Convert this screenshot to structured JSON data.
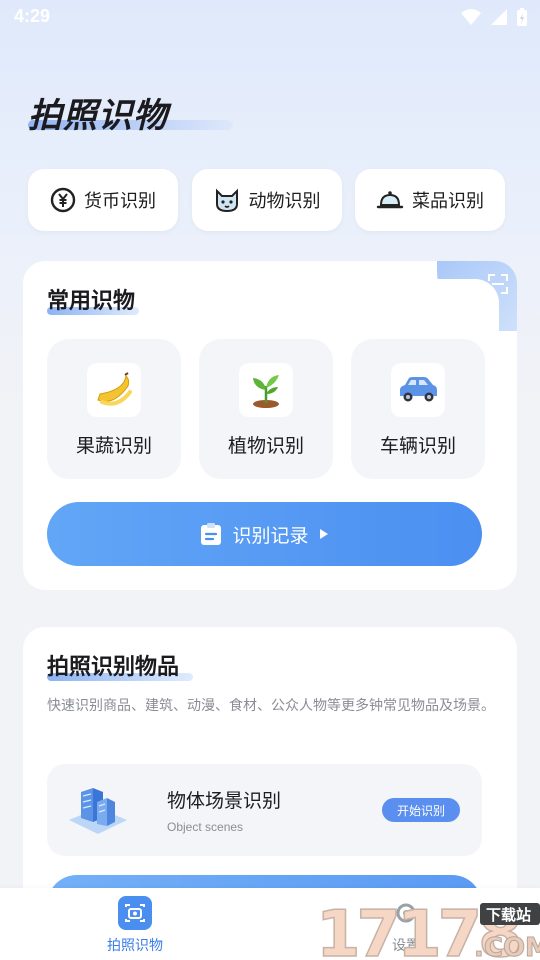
{
  "status": {
    "time": "4:29"
  },
  "page_title": "拍照识物",
  "quick": [
    {
      "label": "货币识别",
      "icon": "currency-icon"
    },
    {
      "label": "动物识别",
      "icon": "cat-icon"
    },
    {
      "label": "菜品识别",
      "icon": "dish-cloche-icon"
    }
  ],
  "common": {
    "title": "常用识物",
    "tiles": [
      {
        "label": "果蔬识别",
        "icon": "banana-icon"
      },
      {
        "label": "植物识别",
        "icon": "plant-icon"
      },
      {
        "label": "车辆识别",
        "icon": "car-icon"
      }
    ],
    "record_label": "识别记录"
  },
  "photo": {
    "title": "拍照识别物品",
    "desc": "快速识别商品、建筑、动漫、食材、公众人物等更多钟常见物品及场景。",
    "item_title": "物体场景识别",
    "item_sub": "Object scenes",
    "start_label": "开始识别"
  },
  "nav": {
    "items": [
      {
        "label": "拍照识物"
      },
      {
        "label": "设置"
      }
    ]
  },
  "watermark": {
    "numbers": "17178",
    "site": "下载站",
    "domain": ".COM"
  },
  "colors": {
    "accent": "#4b8ff1",
    "nav_active": "#3a7de8"
  }
}
